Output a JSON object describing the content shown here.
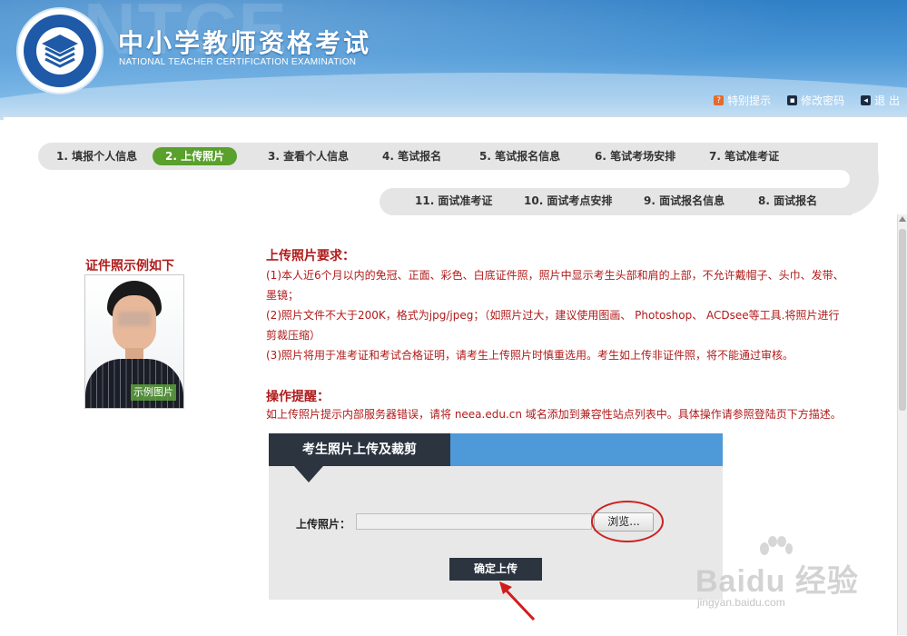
{
  "header": {
    "title": "中小学教师资格考试",
    "subtitle": "NATIONAL TEACHER CERTIFICATION EXAMINATION",
    "ghost_text": "NTCE",
    "logo_text": "National Teacher Certification Examination",
    "links": [
      {
        "label": "特别提示",
        "icon": "hint-icon"
      },
      {
        "label": "修改密码",
        "icon": "key-icon"
      },
      {
        "label": "退 出",
        "icon": "exit-icon"
      }
    ]
  },
  "steps": {
    "row1": [
      "1. 填报个人信息",
      "2. 上传照片",
      "3. 查看个人信息",
      "4. 笔试报名",
      "5. 笔试报名信息",
      "6. 笔试考场安排",
      "7. 笔试准考证"
    ],
    "row2": [
      "11. 面试准考证",
      "10. 面试考点安排",
      "9. 面试报名信息",
      "8. 面试报名"
    ],
    "active_index": 1
  },
  "sample": {
    "title": "证件照示例如下",
    "badge": "示例图片"
  },
  "requirements": {
    "title": "上传照片要求：",
    "items": [
      "(1)本人近6个月以内的免冠、正面、彩色、白底证件照，照片中显示考生头部和肩的上部，不允许戴帽子、头巾、发带、墨镜；",
      "(2)照片文件不大于200K，格式为jpg/jpeg；（如照片过大，建议使用图画、 Photoshop、 ACDsee等工具.将照片进行剪裁压缩）",
      "(3)照片将用于准考证和考试合格证明，请考生上传照片时慎重选用。考生如上传非证件照，将不能通过审核。"
    ]
  },
  "tip": {
    "title": "操作提醒：",
    "text": "如上传照片提示内部服务器错误，请将 neea.edu.cn 域名添加到兼容性站点列表中。具体操作请参照登陆页下方描述。"
  },
  "upload_panel": {
    "tab_label": "考生照片上传及裁剪",
    "field_label": "上传照片：",
    "file_value": "",
    "browse_label": "浏览...",
    "submit_label": "确定上传"
  },
  "watermark": {
    "main": "Baidu 经验",
    "sub": "jingyan.baidu.com"
  },
  "colors": {
    "header_blue": "#3a88cc",
    "active_step": "#5aa02c",
    "red_text": "#b01b1b",
    "dark_button": "#2c3440",
    "panel_blue": "#4e9ad8"
  }
}
